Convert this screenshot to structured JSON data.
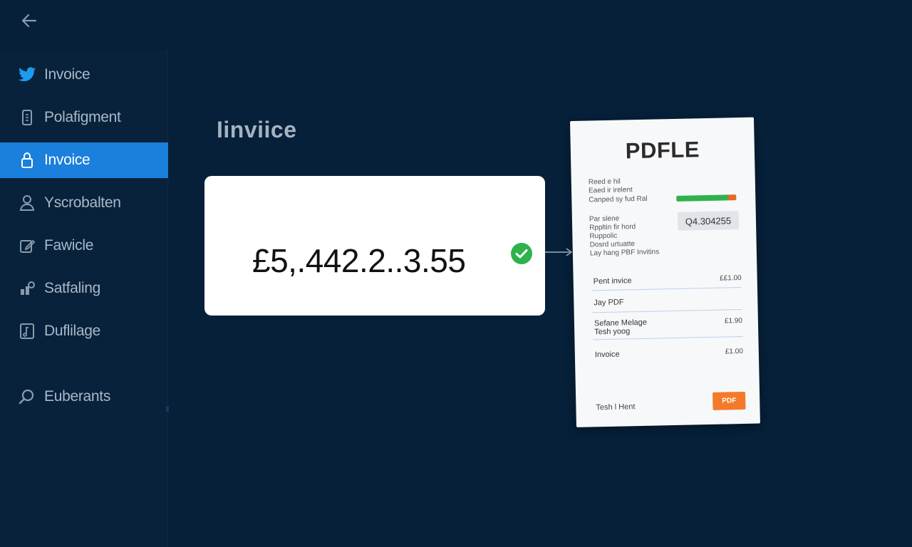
{
  "colors": {
    "background": "#062039",
    "sidebar": "#08223c",
    "active": "#1b7fdc",
    "success": "#2fb24c",
    "pdf_accent": "#f47a2a"
  },
  "header": {
    "back_icon": "arrow-left-icon"
  },
  "sidebar": {
    "items": [
      {
        "label": "Invoice",
        "icon": "bird-logo-icon",
        "active": false
      },
      {
        "label": "Polafigment",
        "icon": "document-icon",
        "active": false
      },
      {
        "label": "Invoice",
        "icon": "lock-icon",
        "active": true
      },
      {
        "label": "Yscrobalten",
        "icon": "person-icon",
        "active": false
      },
      {
        "label": "Fawicle",
        "icon": "edit-icon",
        "active": false
      },
      {
        "label": "Satfaling",
        "icon": "chart-icon",
        "active": false
      },
      {
        "label": "Duflilage",
        "icon": "note-icon",
        "active": false
      },
      {
        "label": "Euberants",
        "icon": "search-icon",
        "active": false
      }
    ]
  },
  "main": {
    "title": "Iinviice",
    "amount": "£5,.442.2..3.55",
    "status_icon": "check-circle-icon"
  },
  "pdf": {
    "title": "PDFLE",
    "meta_lines": [
      "Reed e hil",
      "Eaed ir irelent",
      "Canped sy fud Ral"
    ],
    "detail_lines": [
      "Par slene",
      "Rppltin fir hord",
      "Ruppolic",
      "Dosrd urtuatte",
      "Lay hang PBF Invitins"
    ],
    "total_box": "Q4.304255",
    "rows": [
      {
        "label": "Pent invice",
        "value": "££1.00"
      },
      {
        "label": "Jay PDF",
        "value": ""
      },
      {
        "label": "Sefane Melage\nTesh yoog",
        "value": "£1.90"
      },
      {
        "label": "Invoice",
        "value": "£1.00"
      }
    ],
    "footer": "Tesh l Hent",
    "button": "PDF"
  }
}
